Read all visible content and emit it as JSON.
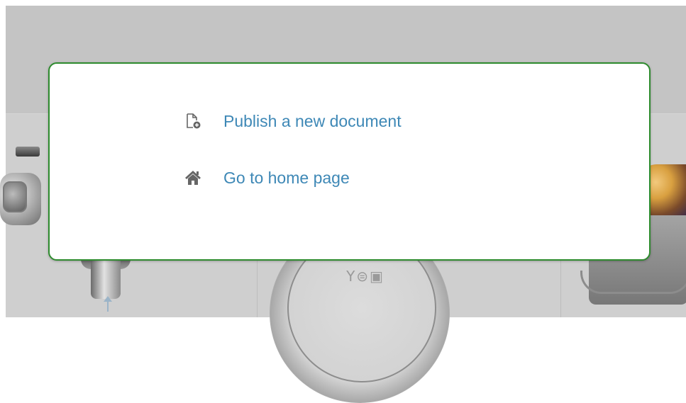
{
  "menu": {
    "items": [
      {
        "label": "Publish a new document",
        "icon": "new-document-icon"
      },
      {
        "label": "Go to home page",
        "icon": "home-icon"
      }
    ]
  },
  "background": {
    "dial_symbols": "Y⊜▣"
  },
  "colors": {
    "link": "#3e88b6",
    "popup_border": "#2e8b2e",
    "icon": "#666666",
    "backdrop": "#c4c4c4"
  }
}
